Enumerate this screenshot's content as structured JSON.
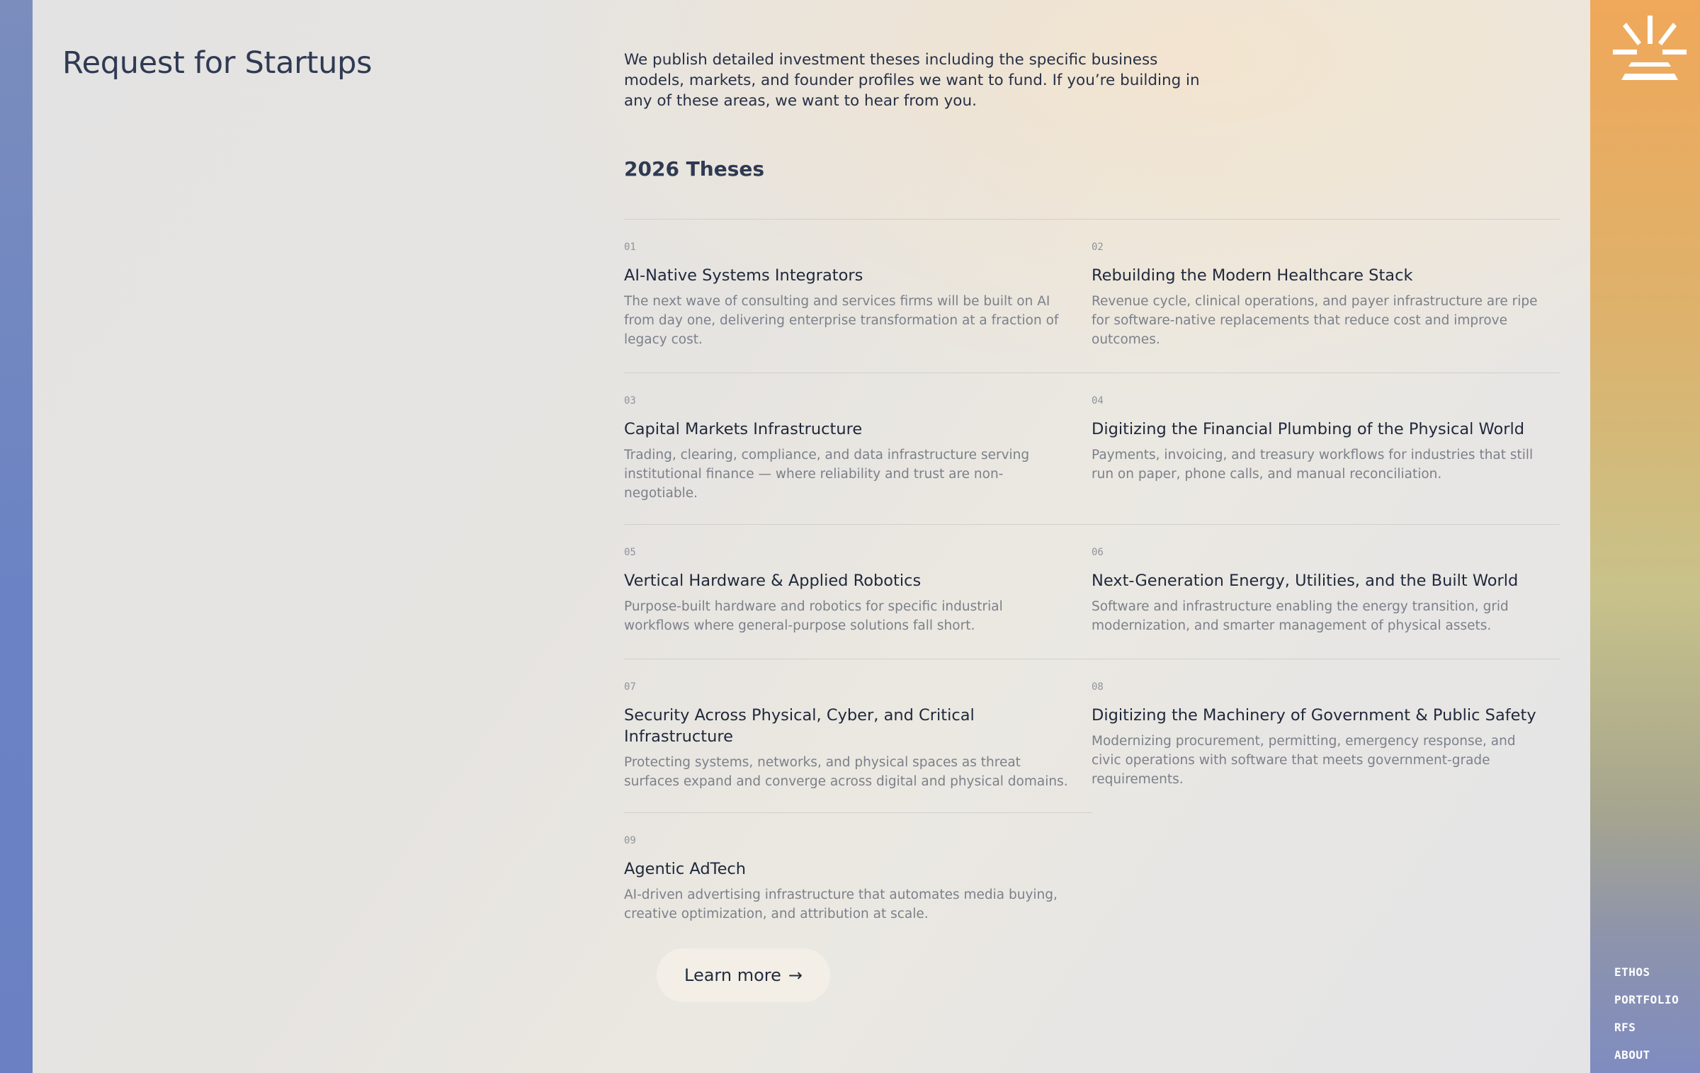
{
  "header": {
    "title": "Request for Startups"
  },
  "intro": {
    "text": "We publish detailed investment theses including the specific business models, markets, and founder profiles we want to fund. If you’re building in any of these areas, we want to hear from you."
  },
  "theses": {
    "heading": "2026 Theses",
    "items": [
      {
        "num": "01",
        "title": "AI-Native Systems Integrators",
        "desc": "The next wave of consulting and services firms will be built on AI from day one, delivering enterprise transformation at a fraction of legacy cost."
      },
      {
        "num": "02",
        "title": "Rebuilding the Modern Healthcare Stack",
        "desc": "Revenue cycle, clinical operations, and payer infrastructure are ripe for software-native replacements that reduce cost and improve outcomes."
      },
      {
        "num": "03",
        "title": "Capital Markets Infrastructure",
        "desc": "Trading, clearing, compliance, and data infrastructure serving institutional finance — where reliability and trust are non-negotiable."
      },
      {
        "num": "04",
        "title": "Digitizing the Financial Plumbing of the Physical World",
        "desc": "Payments, invoicing, and treasury workflows for industries that still run on paper, phone calls, and manual reconciliation."
      },
      {
        "num": "05",
        "title": "Vertical Hardware & Applied Robotics",
        "desc": "Purpose-built hardware and robotics for specific industrial workflows where general-purpose solutions fall short."
      },
      {
        "num": "06",
        "title": "Next-Generation Energy, Utilities, and the Built World",
        "desc": "Software and infrastructure enabling the energy transition, grid modernization, and smarter management of physical assets."
      },
      {
        "num": "07",
        "title": "Security Across Physical, Cyber, and Critical Infrastructure",
        "desc": "Protecting systems, networks, and physical spaces as threat surfaces expand and converge across digital and physical domains."
      },
      {
        "num": "08",
        "title": "Digitizing the Machinery of Government & Public Safety",
        "desc": "Modernizing procurement, permitting, emergency response, and civic operations with software that meets government-grade requirements."
      },
      {
        "num": "09",
        "title": "Agentic AdTech",
        "desc": "AI-driven advertising infrastructure that automates media buying, creative optimization, and attribution at scale."
      }
    ]
  },
  "cta": {
    "label": "Learn more",
    "arrow": "→"
  },
  "nav": {
    "items": [
      "ETHOS",
      "PORTFOLIO",
      "RFS",
      "ABOUT"
    ]
  },
  "colors": {
    "accent_orange": "#f0a85a",
    "sidebar_blue": "#6b83c4",
    "button_bg": "#f3efe6",
    "text_dark": "#2b3346",
    "text_muted": "#7b808a"
  },
  "icons": {
    "logo": "sunrise-logo-icon",
    "cta_arrow": "arrow-right-icon"
  }
}
